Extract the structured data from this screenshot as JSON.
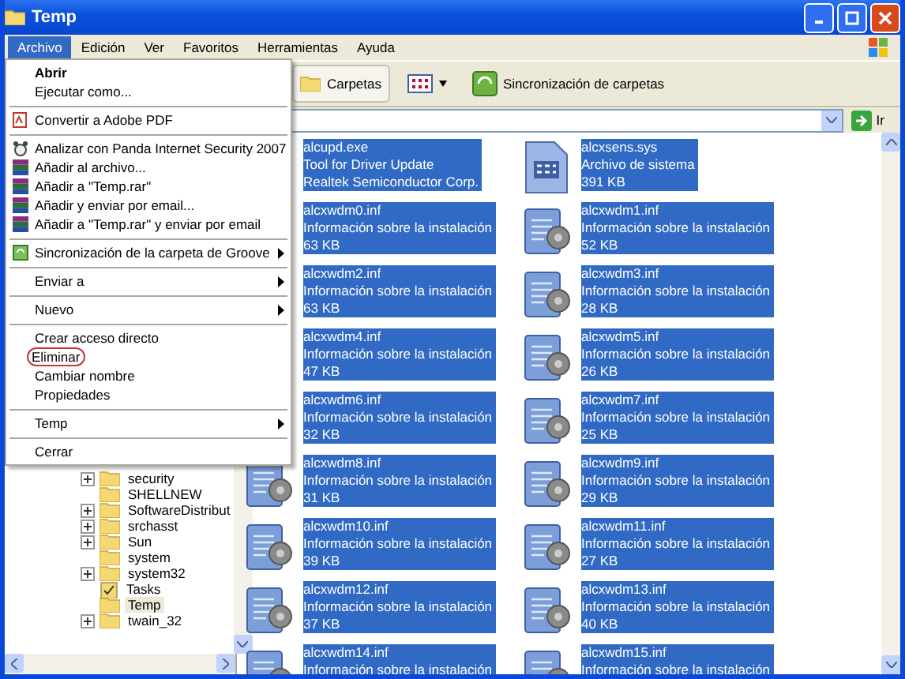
{
  "window": {
    "title": "Temp"
  },
  "menu_bar": [
    {
      "label": "Archivo",
      "selected": true
    },
    {
      "label": "Edición",
      "selected": false
    },
    {
      "label": "Ver",
      "selected": false
    },
    {
      "label": "Favoritos",
      "selected": false
    },
    {
      "label": "Herramientas",
      "selected": false
    },
    {
      "label": "Ayuda",
      "selected": false
    }
  ],
  "toolbar": {
    "folders_button": "Carpetas",
    "sync_button": "Sincronización de carpetas"
  },
  "address_bar": {
    "go_button": "Ir"
  },
  "file_menu": [
    [
      {
        "label": "Abrir",
        "kind": "plain",
        "default": true,
        "submenu": false,
        "circled": false
      },
      {
        "label": "Ejecutar como...",
        "kind": "plain",
        "default": false,
        "submenu": false,
        "circled": false
      }
    ],
    [
      {
        "label": "Convertir a Adobe PDF",
        "kind": "pdf",
        "default": false,
        "submenu": false,
        "circled": false
      }
    ],
    [
      {
        "label": "Analizar con Panda Internet Security 2007",
        "kind": "scan",
        "default": false,
        "submenu": false,
        "circled": false
      },
      {
        "label": "Añadir al archivo...",
        "kind": "archive",
        "default": false,
        "submenu": false,
        "circled": false
      },
      {
        "label": "Añadir a \"Temp.rar\"",
        "kind": "archive",
        "default": false,
        "submenu": false,
        "circled": false
      },
      {
        "label": "Añadir y enviar por email...",
        "kind": "archive",
        "default": false,
        "submenu": false,
        "circled": false
      },
      {
        "label": "Añadir a \"Temp.rar\" y enviar por email",
        "kind": "archive",
        "default": false,
        "submenu": false,
        "circled": false
      }
    ],
    [
      {
        "label": "Sincronización de la carpeta de Groove",
        "kind": "sync",
        "default": false,
        "submenu": true,
        "circled": false
      }
    ],
    [
      {
        "label": "Enviar a",
        "kind": "plain",
        "default": false,
        "submenu": true,
        "circled": false
      }
    ],
    [
      {
        "label": "Nuevo",
        "kind": "plain",
        "default": false,
        "submenu": true,
        "circled": false
      }
    ],
    [
      {
        "label": "Crear acceso directo",
        "kind": "plain",
        "default": false,
        "submenu": false,
        "circled": false
      },
      {
        "label": "Eliminar",
        "kind": "plain",
        "default": false,
        "submenu": false,
        "circled": true
      },
      {
        "label": "Cambiar nombre",
        "kind": "plain",
        "default": false,
        "submenu": false,
        "circled": false
      },
      {
        "label": "Propiedades",
        "kind": "plain",
        "default": false,
        "submenu": false,
        "circled": false
      }
    ],
    [
      {
        "label": "Temp",
        "kind": "plain",
        "default": false,
        "submenu": true,
        "circled": false
      }
    ],
    [
      {
        "label": "Cerrar",
        "kind": "plain",
        "default": false,
        "submenu": false,
        "circled": false
      }
    ]
  ],
  "tree": [
    {
      "label": "security",
      "kind": "folder",
      "expandable": true,
      "selected": false
    },
    {
      "label": "SHELLNEW",
      "kind": "folder",
      "expandable": false,
      "selected": false
    },
    {
      "label": "SoftwareDistribut",
      "kind": "folder",
      "expandable": true,
      "selected": false
    },
    {
      "label": "srchasst",
      "kind": "folder",
      "expandable": true,
      "selected": false
    },
    {
      "label": "Sun",
      "kind": "folder",
      "expandable": true,
      "selected": false
    },
    {
      "label": "system",
      "kind": "folder",
      "expandable": false,
      "selected": false
    },
    {
      "label": "system32",
      "kind": "folder",
      "expandable": true,
      "selected": false
    },
    {
      "label": "Tasks",
      "kind": "tasks",
      "expandable": false,
      "selected": false
    },
    {
      "label": "Temp",
      "kind": "folder",
      "expandable": false,
      "selected": true
    },
    {
      "label": "twain_32",
      "kind": "folder",
      "expandable": true,
      "selected": false
    }
  ],
  "files": [
    {
      "name": "alcupd.exe",
      "type": "Tool for Driver Update",
      "size": "Realtek Semiconductor Corp.",
      "kind": "exe",
      "selected": true
    },
    {
      "name": "alcxsens.sys",
      "type": "Archivo de sistema",
      "size": "391 KB",
      "kind": "sys",
      "selected": true
    },
    {
      "name": "alcxwdm0.inf",
      "type": "Información sobre la instalación",
      "size": "63 KB",
      "kind": "inf",
      "selected": true
    },
    {
      "name": "alcxwdm1.inf",
      "type": "Información sobre la instalación",
      "size": "52 KB",
      "kind": "inf",
      "selected": true
    },
    {
      "name": "alcxwdm2.inf",
      "type": "Información sobre la instalación",
      "size": "63 KB",
      "kind": "inf",
      "selected": true
    },
    {
      "name": "alcxwdm3.inf",
      "type": "Información sobre la instalación",
      "size": "28 KB",
      "kind": "inf",
      "selected": true
    },
    {
      "name": "alcxwdm4.inf",
      "type": "Información sobre la instalación",
      "size": "47 KB",
      "kind": "inf",
      "selected": true
    },
    {
      "name": "alcxwdm5.inf",
      "type": "Información sobre la instalación",
      "size": "26 KB",
      "kind": "inf",
      "selected": true
    },
    {
      "name": "alcxwdm6.inf",
      "type": "Información sobre la instalación",
      "size": "32 KB",
      "kind": "inf",
      "selected": true
    },
    {
      "name": "alcxwdm7.inf",
      "type": "Información sobre la instalación",
      "size": "25 KB",
      "kind": "inf",
      "selected": true
    },
    {
      "name": "alcxwdm8.inf",
      "type": "Información sobre la instalación",
      "size": "31 KB",
      "kind": "inf",
      "selected": true
    },
    {
      "name": "alcxwdm9.inf",
      "type": "Información sobre la instalación",
      "size": "29 KB",
      "kind": "inf",
      "selected": true
    },
    {
      "name": "alcxwdm10.inf",
      "type": "Información sobre la instalación",
      "size": "39 KB",
      "kind": "inf",
      "selected": true
    },
    {
      "name": "alcxwdm11.inf",
      "type": "Información sobre la instalación",
      "size": "27 KB",
      "kind": "inf",
      "selected": true
    },
    {
      "name": "alcxwdm12.inf",
      "type": "Información sobre la instalación",
      "size": "37 KB",
      "kind": "inf",
      "selected": true
    },
    {
      "name": "alcxwdm13.inf",
      "type": "Información sobre la instalación",
      "size": "40 KB",
      "kind": "inf",
      "selected": true
    },
    {
      "name": "alcxwdm14.inf",
      "type": "Información sobre la instalación",
      "kind": "inf",
      "selected": true
    },
    {
      "name": "alcxwdm15.inf",
      "type": "Información sobre la instalación",
      "kind": "inf",
      "selected": true
    }
  ]
}
